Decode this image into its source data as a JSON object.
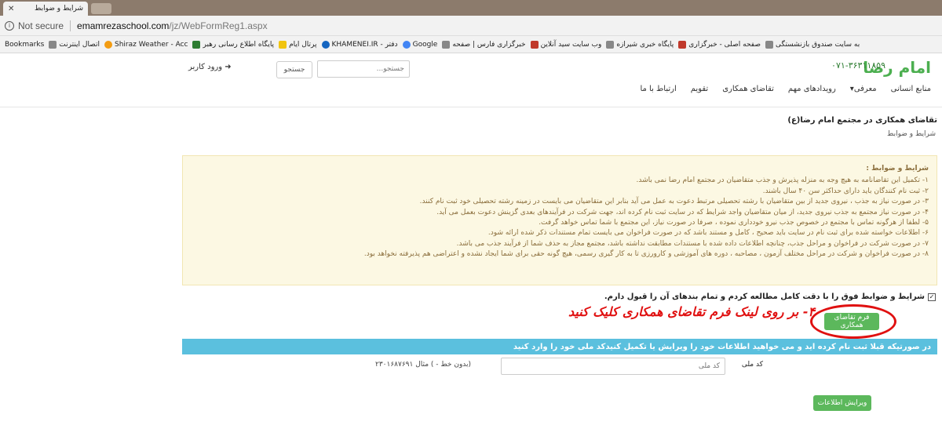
{
  "browser": {
    "tab_title": "شرایط و ضوابط",
    "tab_close": "✕",
    "not_secure": "Not secure",
    "url_host": "emamrezaschool.com",
    "url_path": "/jz/WebFormReg1.aspx"
  },
  "bookmarks": {
    "label": "Bookmarks",
    "items": [
      {
        "label": "اتصال اینترنت",
        "icon": "globe-icon",
        "color": "#888888"
      },
      {
        "label": "Shiraz Weather - Acc",
        "icon": "sun-icon",
        "color": "#f39c12"
      },
      {
        "label": "پایگاه اطلاع رسانی رهبر",
        "icon": "leader-site-icon",
        "color": "#2e7d32"
      },
      {
        "label": "پرتال ایام",
        "icon": "ayam-icon",
        "color": "#f1c40f"
      },
      {
        "label": "KHAMENEI.IR - دفتر",
        "icon": "khamenei-icon",
        "color": "#1565c0"
      },
      {
        "label": "Google",
        "icon": "google-icon",
        "color": "#4285f4"
      },
      {
        "label": "خبرگزاری فارس | صفحه",
        "icon": "page-icon",
        "color": "#888888"
      },
      {
        "label": "وب سایت سید آنلاین",
        "icon": "seyyed-icon",
        "color": "#c0392b"
      },
      {
        "label": "پایگاه خبری شیرازه",
        "icon": "page-icon",
        "color": "#888888"
      },
      {
        "label": "صفحه اصلی - خبرگزاری",
        "icon": "news-icon",
        "color": "#c0392b"
      },
      {
        "label": "به سایت صندوق بازنشستگی",
        "icon": "doc-icon",
        "color": "#888888"
      }
    ]
  },
  "site": {
    "logo": "امام رضا",
    "phone": "۰۷۱-۳۶۳۱۱۸۵۹",
    "search_placeholder": "جستجو...",
    "search_button": "جستجو",
    "login": "ورود کاربر",
    "login_icon": "sign-in-icon",
    "menu": [
      {
        "label": "منابع انسانی"
      },
      {
        "label": "معرفی▾"
      },
      {
        "label": "رویدادهای مهم"
      },
      {
        "label": "تقاضای همکاری"
      },
      {
        "label": "تقویم"
      },
      {
        "label": "ارتباط با ما"
      }
    ]
  },
  "page": {
    "title": "تقاضای همکاری در مجتمع امام رضا(ع)",
    "breadcrumb": "شرایط و ضوابط"
  },
  "terms": {
    "title": "شرایط و ضوابط :",
    "items": [
      "۱- تکمیل این تقاضانامه به هیچ وجه به منزله پذیرش و جذب متقاضیان در مجتمع امام رضا نمی باشد.",
      "۲- ثبت نام کنندگان باید دارای حداکثر سن ۴۰ سال باشند.",
      "۳- در صورت نیاز به جذب ، نیروی جدید از بین متقاضیان با رشته تحصیلی مرتبط دعوت به عمل می آید بنابر این متقاضیان می بایست در زمینه رشته تحصیلی خود ثبت نام کنند.",
      "۴- در صورت نیاز مجتمع به جذب نیروی جدید، از میان متقاضیان واجد شرایط که در سایت ثبت نام کرده اند، جهت شرکت در فرآیندهای بعدی گزینش دعوت بعمل می آید.",
      "۵- لطفا از هرگونه تماس با مجتمع در خصوص جذب نیرو خودداری نموده ، صرفا در صورت نیاز، این مجتمع با شما تماس خواهد گرفت.",
      "۶- اطلاعات خواسته شده برای ثبت نام در سایت باید صحیح ، کامل و مستند باشد که در صورت فراخوان می بایست تمام مستندات ذکر شده ارائه شود.",
      "۷- در صورت شرکت در فراخوان و مراحل جذب، چنانچه اطلاعات داده شده با مستندات مطابقت نداشته باشد، مجتمع مجاز به حذف شما از فرآیند جذب می باشد.",
      "۸- در صورت فراخوان و شرکت در مراحل مختلف آزمون ، مصاحبه ، دوره های آموزشی و کارورزی تا به کار گیری رسمی، هیچ گونه حقی برای شما ایجاد نشده و اعتراضی هم پذیرفته نخواهد بود."
    ]
  },
  "agree": {
    "text": "شرایط و ضوابط فوق را با دقت کامل مطالعه کردم و تمام بندهای آن را قبول دارم.",
    "checked": true
  },
  "form_button": "فرم تقاضای همکاری",
  "annotation": "۴- بر روی لینک فرم تقاضای همکاری کلیک کنید",
  "info_bar": "در صورتیکه قبلا ثبت نام کرده اید و می خواهید اطلاعات خود را ویرایش یا تکمیل کنیدکد ملی خود را وارد کنید",
  "national_id": {
    "label": "کد ملی",
    "placeholder": "کد ملی",
    "hint": "(بدون خط - ) مثال ۲۳۰۱۶۸۷۶۹۱"
  },
  "edit_button": "ویرایش اطلاعات",
  "colors": {
    "success": "#5cb85c",
    "info": "#5bc0de",
    "warning_bg": "#fcf8e3",
    "warning_text": "#8a6d3b",
    "annotation": "#e01010"
  }
}
